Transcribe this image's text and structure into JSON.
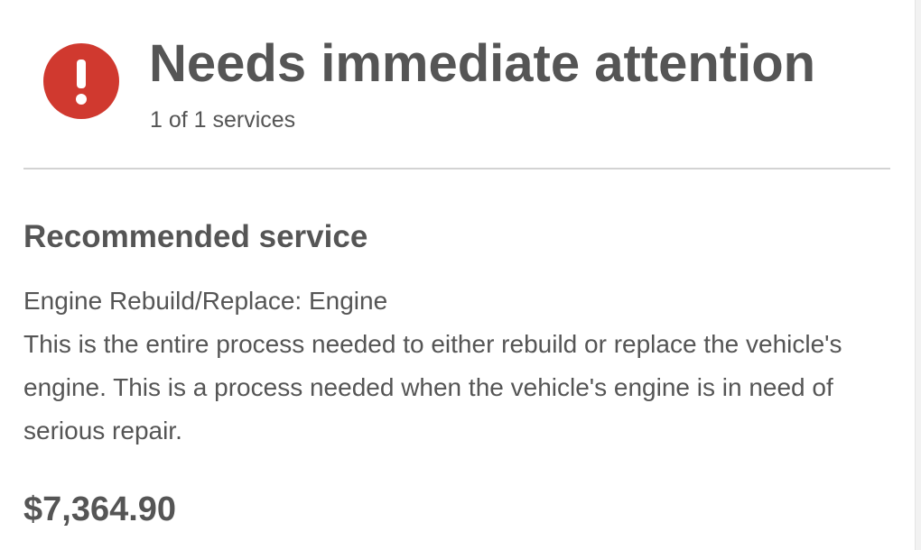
{
  "status": {
    "icon": "exclamation-circle-icon",
    "icon_color": "#d0392f",
    "title": "Needs immediate attention",
    "subtitle": "1 of 1 services"
  },
  "recommended": {
    "heading": "Recommended service",
    "service_name": "Engine Rebuild/Replace: Engine",
    "description": "This is the entire process needed to either rebuild or replace the vehicle's engine. This is a process needed when the vehicle's engine is in need of serious repair.",
    "price": "$7,364.90"
  }
}
